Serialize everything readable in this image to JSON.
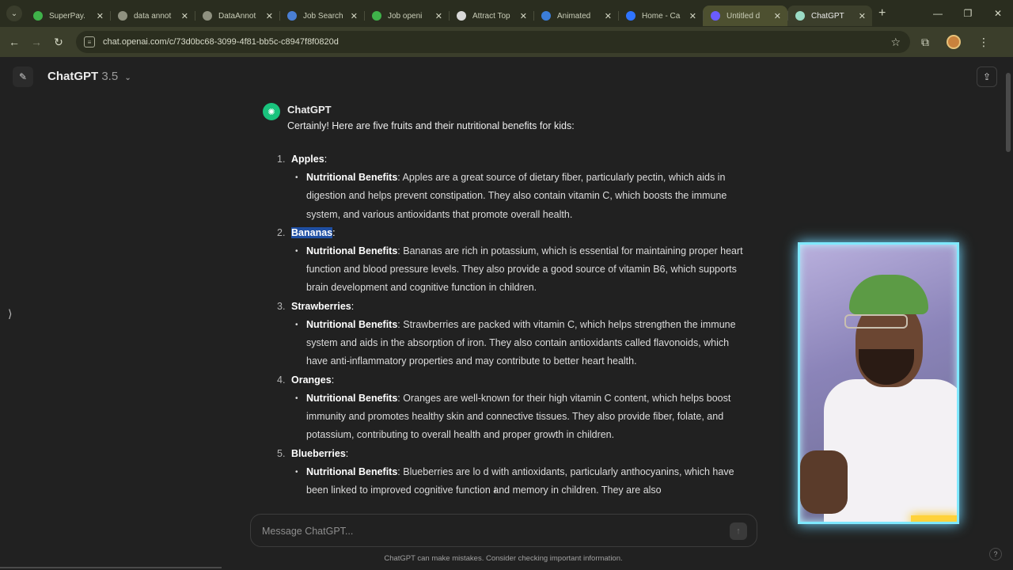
{
  "browser": {
    "tabs": [
      {
        "title": "SuperPay.",
        "icon": "superpay-favicon",
        "color": "#3fb24a"
      },
      {
        "title": "data annot",
        "icon": "globe-favicon",
        "color": "#8f9180"
      },
      {
        "title": "DataAnnot",
        "icon": "dataannotation-favicon",
        "color": "#8f9180"
      },
      {
        "title": "Job Search",
        "icon": "search-favicon",
        "color": "#4a7fd4"
      },
      {
        "title": "Job openi",
        "icon": "job-favicon",
        "color": "#3fb24a"
      },
      {
        "title": "Attract Top",
        "icon": "pen-favicon",
        "color": "#d8d8d8"
      },
      {
        "title": "Animated",
        "icon": "ad-favicon",
        "color": "#3b7dd8"
      },
      {
        "title": "Home - Ca",
        "icon": "chrome-favicon",
        "color": "#2f74ff"
      },
      {
        "title": "Untitled d",
        "icon": "video-favicon",
        "color": "#6a5cff"
      },
      {
        "title": "ChatGPT",
        "icon": "chatgpt-favicon",
        "color": "#9adbc5"
      }
    ],
    "url": "chat.openai.com/c/73d0bc68-3099-4f81-bb5c-c8947f8f0820d",
    "new_tab": "+",
    "close": "✕"
  },
  "header": {
    "model_name": "ChatGPT",
    "model_version": "3.5"
  },
  "message": {
    "author": "ChatGPT",
    "intro": "Certainly! Here are five fruits and their nutritional benefits for kids:",
    "label": "Nutritional Benefits",
    "items": [
      {
        "num": "1.",
        "name": "Apples",
        "suffix": ":",
        "text": ": Apples are a great source of dietary fiber, particularly pectin, which aids in digestion and helps prevent constipation. They also contain vitamin C, which boosts the immune system, and various antioxidants that promote overall health."
      },
      {
        "num": "2.",
        "name": "Bananas",
        "suffix": ":",
        "text": ": Bananas are rich in potassium, which is essential for maintaining proper heart function and blood pressure levels. They also provide a good source of vitamin B6, which supports brain development and cognitive function in children."
      },
      {
        "num": "3.",
        "name": "Strawberries",
        "suffix": ":",
        "text": ": Strawberries are packed with vitamin C, which helps strengthen the immune system and aids in the absorption of iron. They also contain antioxidants called flavonoids, which have anti-inflammatory properties and may contribute to better heart health."
      },
      {
        "num": "4.",
        "name": "Oranges",
        "suffix": ":",
        "text": ": Oranges are well-known for their high vitamin C content, which helps boost immunity and promotes healthy skin and connective tissues. They also provide fiber, folate, and potassium, contributing to overall health and proper growth in children."
      },
      {
        "num": "5.",
        "name": "Blueberries",
        "suffix": ":",
        "text": ": Blueberries are lo     d with antioxidants, particularly anthocyanins, which have been linked to improved cognitive function and memory in children. They are also"
      }
    ]
  },
  "composer": {
    "placeholder": "Message ChatGPT..."
  },
  "footer": {
    "disclaimer": "ChatGPT can make mistakes. Consider checking important information.",
    "help": "?"
  }
}
